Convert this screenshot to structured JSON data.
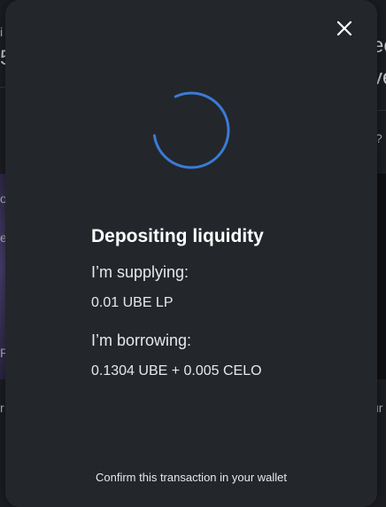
{
  "background": {
    "fragments_left": [
      "i",
      "5",
      "o",
      "e",
      "R",
      "r"
    ],
    "fragments_right": [
      "ee",
      "ve",
      "?",
      "ur"
    ]
  },
  "modal": {
    "close_icon": "close-icon",
    "status_icon": "loading-spinner",
    "title": "Depositing liquidity",
    "supplying_label": "I’m supplying:",
    "supplying_value": "0.01 UBE LP",
    "borrowing_label": "I’m borrowing:",
    "borrowing_value": "0.1304 UBE + 0.005 CELO",
    "footer_text": "Confirm this transaction in your wallet"
  },
  "colors": {
    "modal_bg": "#23262b",
    "spinner": "#3a7bd5",
    "text": "#ffffff"
  }
}
